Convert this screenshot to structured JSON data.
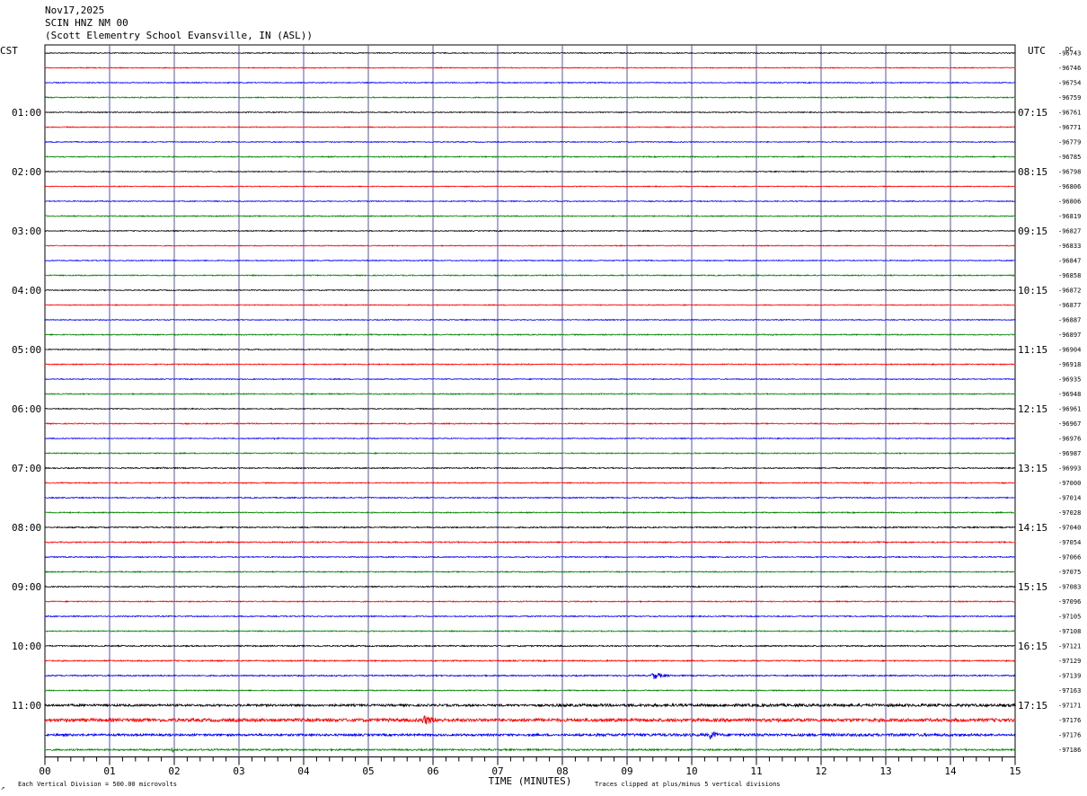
{
  "header": {
    "date": "Nov17,2025",
    "channel": "SCIN HNZ NM 00",
    "station": "(Scott Elementry School Evansville, IN (ASL))"
  },
  "left_axis_title": "CST",
  "right_axis_title": "UTC",
  "dc_title": "DC",
  "footer": {
    "scale_note": "Each Vertical Division =  500.00 microvolts",
    "clip_note": "Traces clipped at plus/minus 5 vertical divisions",
    "corner_mark": "↗"
  },
  "colors": {
    "trace_cycle": [
      "#000000",
      "#ff0000",
      "#0000ff",
      "#008000"
    ],
    "minute_grid": "#5555aa",
    "background": "#ffffff"
  },
  "chart_data": {
    "type": "helicorder",
    "xlabel": "TIME (MINUTES)",
    "xlim": [
      0,
      15
    ],
    "x_ticks": [
      "00",
      "01",
      "02",
      "03",
      "04",
      "05",
      "06",
      "07",
      "08",
      "09",
      "10",
      "11",
      "12",
      "13",
      "14",
      "15"
    ],
    "rows": 48,
    "row_duration_minutes": 15,
    "left_time_labels": [
      "",
      "01:00",
      "02:00",
      "03:00",
      "04:00",
      "05:00",
      "06:00",
      "07:00",
      "08:00",
      "09:00",
      "10:00",
      "11:00"
    ],
    "right_time_labels": [
      "",
      "07:15",
      "08:15",
      "09:15",
      "10:15",
      "11:15",
      "12:15",
      "13:15",
      "14:15",
      "15:15",
      "16:15",
      "17:15"
    ],
    "dc_offsets": [
      "-96743",
      "-96746",
      "-96754",
      "-96759",
      "-96761",
      "-96771",
      "-96779",
      "-96785",
      "-96798",
      "-96806",
      "-96806",
      "-96819",
      "-96827",
      "-96833",
      "-96847",
      "-96858",
      "-96872",
      "-96877",
      "-96887",
      "-96897",
      "-96904",
      "-96918",
      "-96935",
      "-96948",
      "-96961",
      "-96967",
      "-96976",
      "-96987",
      "-96993",
      "-97000",
      "-97014",
      "-97028",
      "-97040",
      "-97054",
      "-97066",
      "-97075",
      "-97083",
      "-97096",
      "-97105",
      "-97108",
      "-97121",
      "-97129",
      "-97139",
      "-97163",
      "-97171",
      "-97176",
      "-97176",
      "-97186"
    ],
    "noise_level": [
      0.5,
      0.5,
      0.5,
      0.6,
      0.5,
      0.5,
      0.5,
      0.6,
      0.5,
      0.5,
      0.5,
      0.6,
      0.5,
      0.5,
      0.5,
      0.6,
      0.5,
      0.5,
      0.5,
      0.6,
      0.5,
      0.6,
      0.5,
      0.6,
      0.5,
      0.6,
      0.5,
      0.6,
      0.6,
      0.6,
      0.6,
      0.6,
      0.7,
      0.7,
      0.6,
      0.6,
      0.6,
      0.6,
      0.6,
      0.6,
      0.7,
      0.7,
      0.7,
      0.6,
      1.2,
      1.8,
      1.2,
      0.9
    ],
    "events": [
      {
        "row": 42,
        "minute": 9.35,
        "amplitude": 6,
        "duration": 0.55
      },
      {
        "row": 44,
        "minute": 7.8,
        "amplitude": 1.5,
        "duration": 7.2
      },
      {
        "row": 44,
        "minute": 11.6,
        "amplitude": 2.5,
        "duration": 0.3
      },
      {
        "row": 44,
        "minute": 13.4,
        "amplitude": 2.5,
        "duration": 0.4
      },
      {
        "row": 45,
        "minute": 0.1,
        "amplitude": 2.5,
        "duration": 1.4
      },
      {
        "row": 45,
        "minute": 5.8,
        "amplitude": 8,
        "duration": 0.6
      },
      {
        "row": 45,
        "minute": 7.0,
        "amplitude": 1.6,
        "duration": 0.5
      },
      {
        "row": 45,
        "minute": 8.55,
        "amplitude": 3,
        "duration": 0.3
      },
      {
        "row": 45,
        "minute": 11.3,
        "amplitude": 3,
        "duration": 0.3
      },
      {
        "row": 46,
        "minute": 10.25,
        "amplitude": 8,
        "duration": 0.35
      },
      {
        "row": 46,
        "minute": 8.5,
        "amplitude": 1.5,
        "duration": 6.0
      },
      {
        "row": 47,
        "minute": 1.95,
        "amplitude": 4,
        "duration": 0.15
      },
      {
        "row": 19,
        "minute": 11.2,
        "amplitude": 1.5,
        "duration": 0.4
      },
      {
        "row": 26,
        "minute": 3.5,
        "amplitude": 1.5,
        "duration": 0.5
      },
      {
        "row": 26,
        "minute": 7.0,
        "amplitude": 1.5,
        "duration": 0.3
      },
      {
        "row": 28,
        "minute": 1.8,
        "amplitude": 2,
        "duration": 0.3
      }
    ]
  }
}
